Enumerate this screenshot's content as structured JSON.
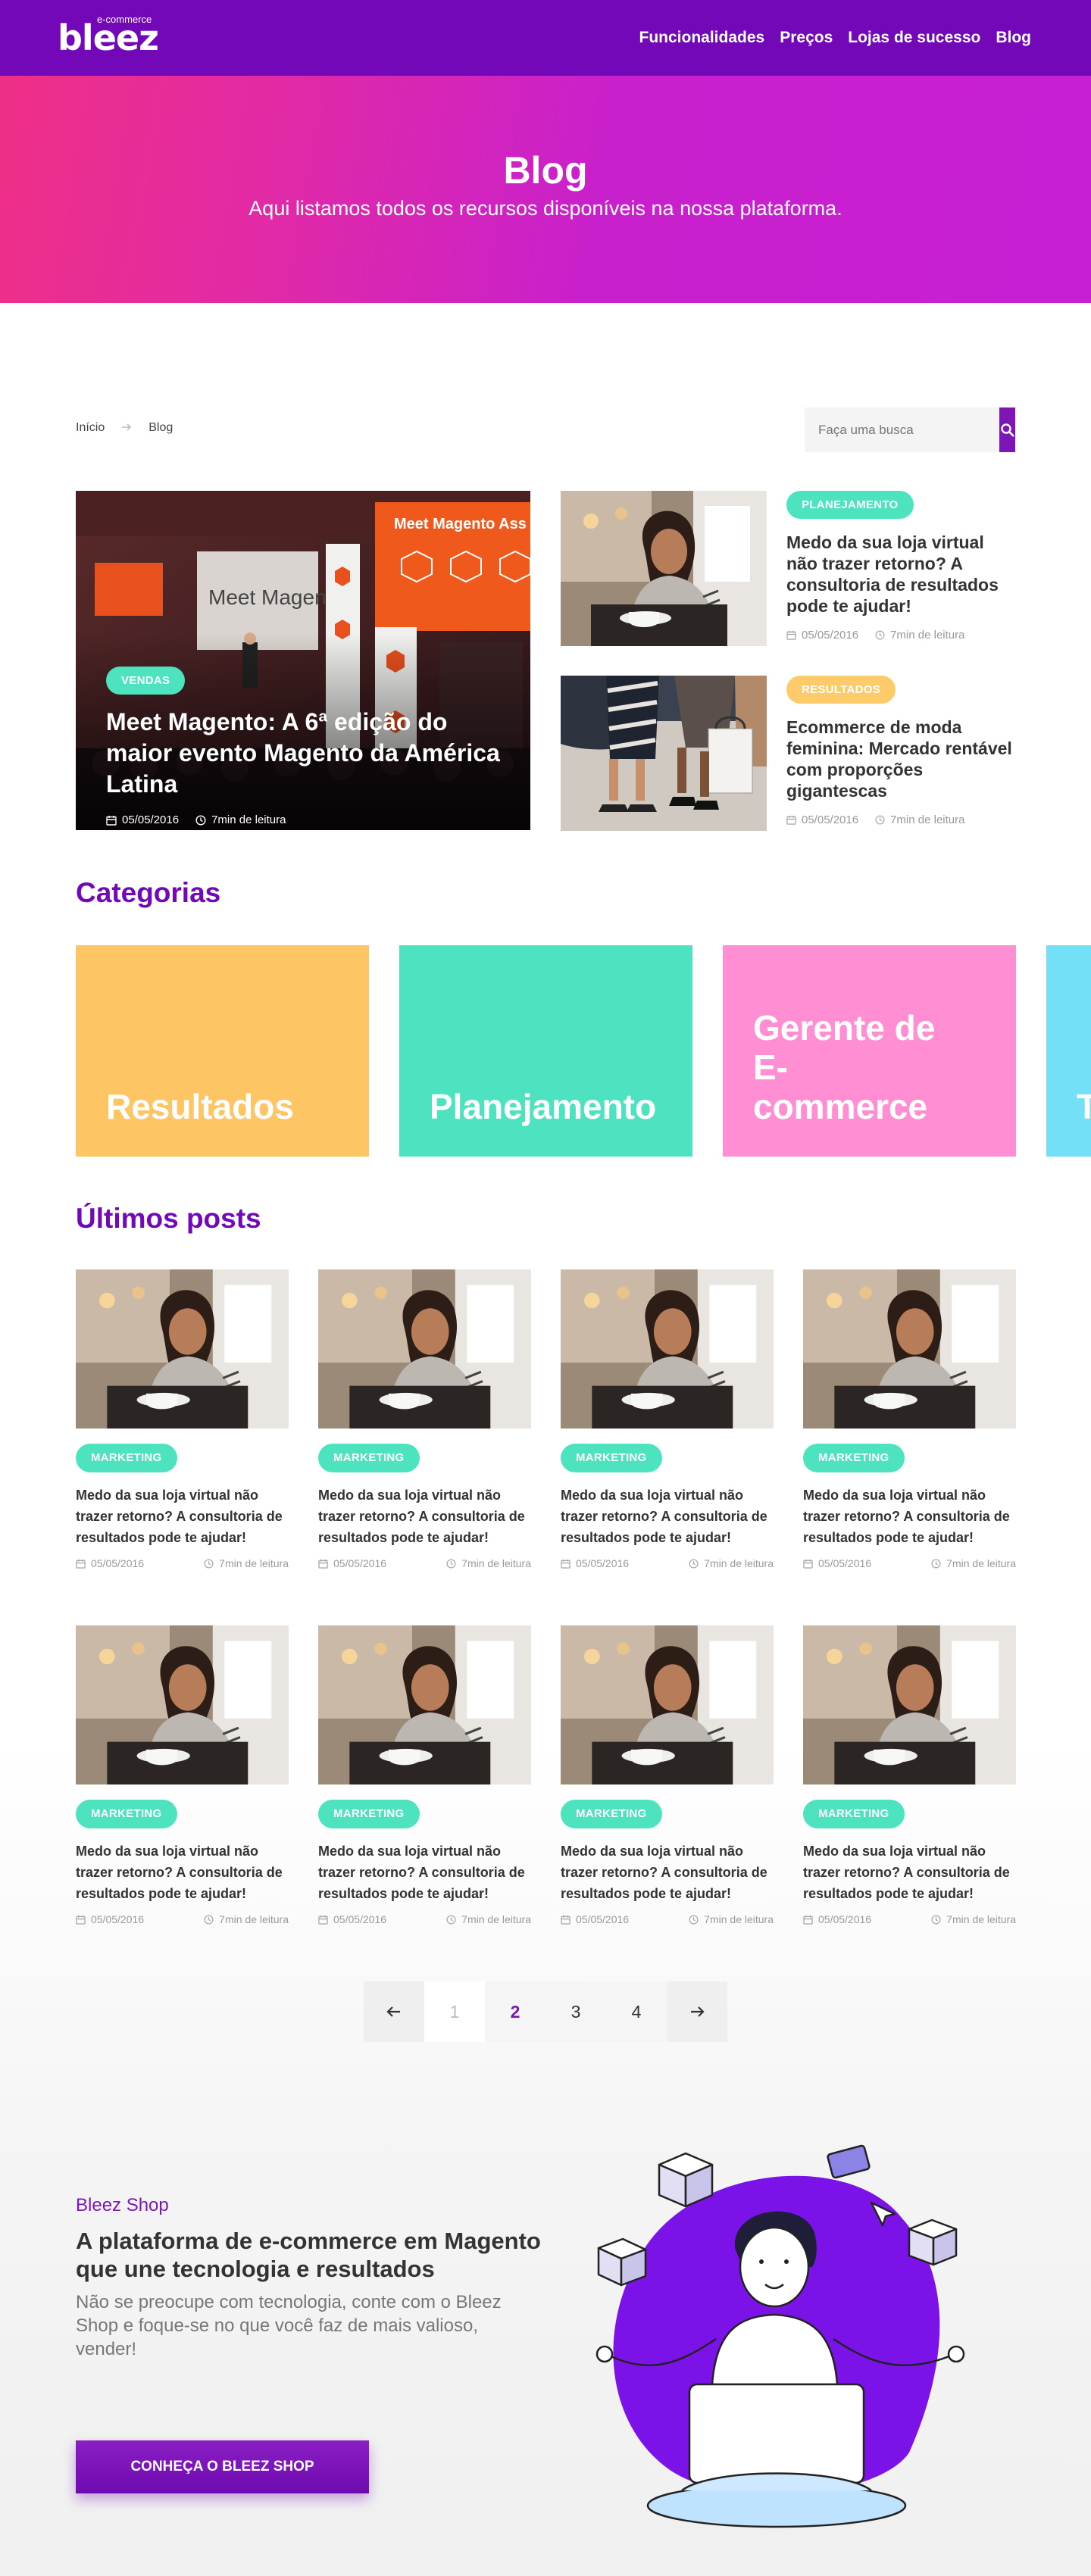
{
  "header": {
    "logo": "bleez",
    "logo_tag": "e-commerce",
    "nav": [
      "Funcionalidades",
      "Preços",
      "Lojas de sucesso",
      "Blog"
    ]
  },
  "hero": {
    "title": "Blog",
    "subtitle": "Aqui listamos todos os recursos disponíveis na nossa plataforma."
  },
  "breadcrumb": {
    "home": "Início",
    "current": "Blog"
  },
  "search": {
    "placeholder": "Faça uma busca"
  },
  "featured": {
    "main": {
      "tag": "VENDAS",
      "title": "Meet Magento: A 6ª edição do maior evento Magento da América Latina",
      "date": "05/05/2016",
      "read": "7min de leitura",
      "image_text": "Meet Magento"
    },
    "side": [
      {
        "tag": "PLANEJAMENTO",
        "title": "Medo da sua loja virtual não trazer retorno? A consultoria de resultados pode te ajudar!",
        "date": "05/05/2016",
        "read": "7min de leitura"
      },
      {
        "tag": "RESULTADOS",
        "title": "Ecommerce de moda feminina: Mercado rentável com proporções gigantescas",
        "date": "05/05/2016",
        "read": "7min de leitura"
      }
    ]
  },
  "categories": {
    "title": "Categorias",
    "items": [
      "Resultados",
      "Planejamento",
      "Gerente de E-commerce",
      "T"
    ]
  },
  "posts": {
    "title": "Últimos posts",
    "items": [
      {
        "tag": "MARKETING",
        "title": "Medo da sua loja virtual não trazer retorno? A consultoria de resultados pode te ajudar!",
        "date": "05/05/2016",
        "read": "7min de leitura"
      },
      {
        "tag": "MARKETING",
        "title": "Medo da sua loja virtual não trazer retorno? A consultoria de resultados pode te ajudar!",
        "date": "05/05/2016",
        "read": "7min de leitura"
      },
      {
        "tag": "MARKETING",
        "title": "Medo da sua loja virtual não trazer retorno? A consultoria de resultados pode te ajudar!",
        "date": "05/05/2016",
        "read": "7min de leitura"
      },
      {
        "tag": "MARKETING",
        "title": "Medo da sua loja virtual não trazer retorno? A consultoria de resultados pode te ajudar!",
        "date": "05/05/2016",
        "read": "7min de leitura"
      },
      {
        "tag": "MARKETING",
        "title": "Medo da sua loja virtual não trazer retorno? A consultoria de resultados pode te ajudar!",
        "date": "05/05/2016",
        "read": "7min de leitura"
      },
      {
        "tag": "MARKETING",
        "title": "Medo da sua loja virtual não trazer retorno? A consultoria de resultados pode te ajudar!",
        "date": "05/05/2016",
        "read": "7min de leitura"
      },
      {
        "tag": "MARKETING",
        "title": "Medo da sua loja virtual não trazer retorno? A consultoria de resultados pode te ajudar!",
        "date": "05/05/2016",
        "read": "7min de leitura"
      },
      {
        "tag": "MARKETING",
        "title": "Medo da sua loja virtual não trazer retorno? A consultoria de resultados pode te ajudar!",
        "date": "05/05/2016",
        "read": "7min de leitura"
      }
    ]
  },
  "pagination": {
    "pages": [
      "1",
      "2",
      "3",
      "4"
    ],
    "current": "2"
  },
  "promo": {
    "kicker": "Bleez Shop",
    "title": "A plataforma de e-commerce em Magento que une tecnologia e resultados",
    "description": "Não se preocupe com tecnologia, conte com o Bleez Shop e foque-se no que você faz de mais valioso, vender!",
    "cta": "CONHEÇA O BLEEZ SHOP"
  },
  "colors": {
    "brand": "#7208b8",
    "accent": "#7d16b5",
    "teal": "#4de3be",
    "orange": "#fecb6a",
    "pink": "#ff8fd2",
    "cyan": "#74e0f7"
  }
}
